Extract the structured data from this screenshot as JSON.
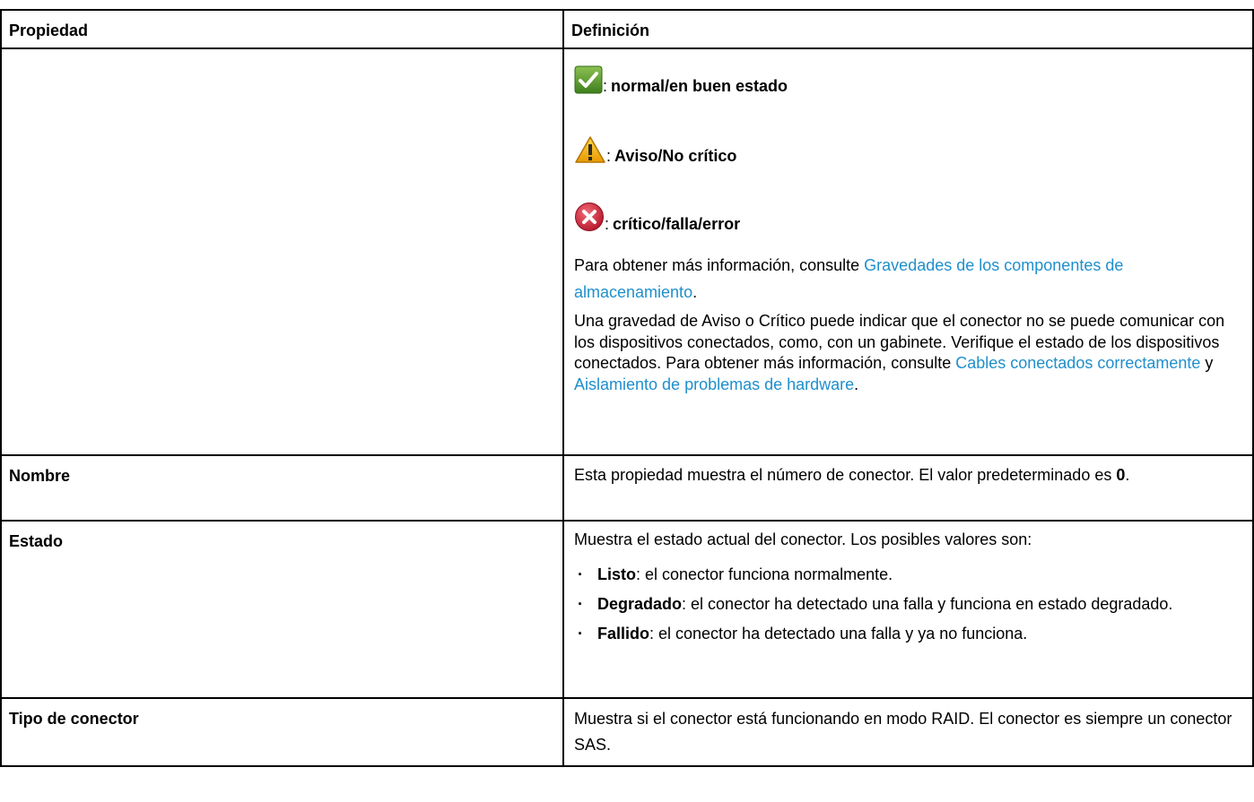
{
  "table": {
    "headers": {
      "property": "Propiedad",
      "definition": "Definición"
    },
    "severity": {
      "items": [
        {
          "icon": "check-icon",
          "label": "normal/en buen estado",
          "color": "#5a9a2c"
        },
        {
          "icon": "warning-icon",
          "label": "Aviso/No crítico",
          "color": "#f2b705"
        },
        {
          "icon": "error-icon",
          "label": "crítico/falla/error",
          "color": "#d12d3d"
        }
      ],
      "more_info_prefix": "Para obtener más información, consulte ",
      "more_info_link": "Gravedades de los componentes de almacenamiento",
      "more_info_suffix": ".",
      "paragraph2_text": "Una gravedad de Aviso o Crítico puede indicar que el conector no se puede comunicar con los dispositivos conectados, como, con un gabinete. Verifique el estado de los dispositivos conectados. Para obtener más información, consulte ",
      "link_cables": "Cables conectados correctamente",
      "and": " y ",
      "link_isolation": "Aislamiento de problemas de hardware",
      "paragraph2_suffix": "."
    },
    "name_row": {
      "property": "Nombre",
      "definition_text": "Esta propiedad muestra el número de conector. El valor predeterminado es ",
      "default_value": "0",
      "definition_suffix": "."
    },
    "state_row": {
      "property": "Estado",
      "intro": "Muestra el estado actual del conector. Los posibles valores son:",
      "bullet": "·",
      "options": [
        {
          "term": "Listo",
          "desc": ": el conector funciona normalmente."
        },
        {
          "term": "Degradado",
          "desc": ": el conector ha detectado una falla y funciona en estado degradado."
        },
        {
          "term": "Fallido",
          "desc": ": el conector ha detectado una falla y ya no funciona."
        }
      ]
    },
    "type_row": {
      "property": "Tipo de conector",
      "definition": "Muestra si el conector está funcionando en modo RAID. El conector es siempre un conector SAS."
    }
  },
  "colors": {
    "link": "#1f8fcc",
    "border": "#000000"
  }
}
